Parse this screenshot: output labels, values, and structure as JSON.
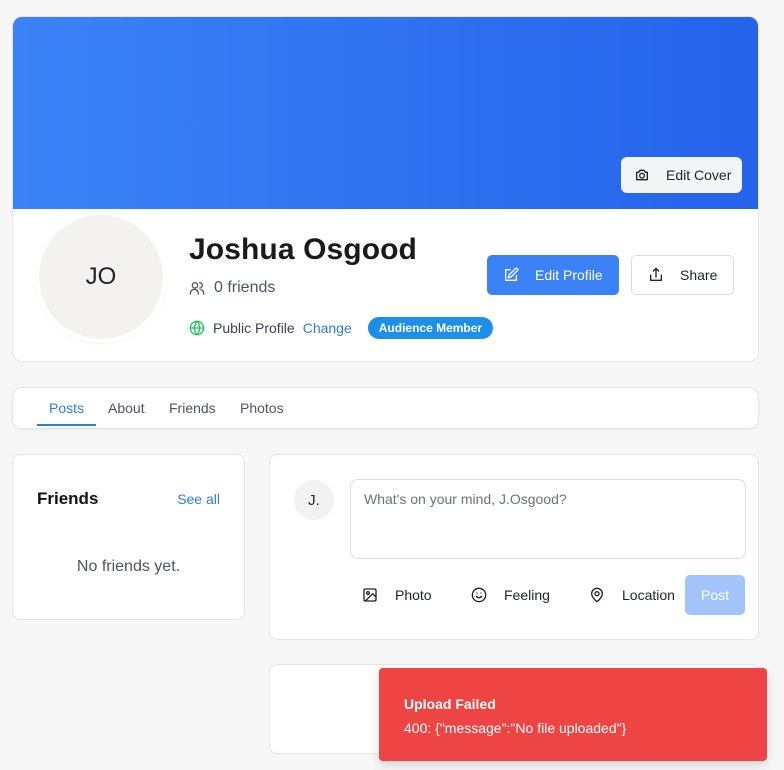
{
  "profile": {
    "initials": "JO",
    "name": "Joshua Osgood",
    "friends_count": "0 friends",
    "visibility": "Public Profile",
    "change_label": "Change",
    "role_badge": "Audience Member",
    "edit_cover_label": "Edit Cover",
    "edit_profile_label": "Edit Profile",
    "share_label": "Share"
  },
  "tabs": [
    {
      "label": "Posts",
      "active": true
    },
    {
      "label": "About",
      "active": false
    },
    {
      "label": "Friends",
      "active": false
    },
    {
      "label": "Photos",
      "active": false
    }
  ],
  "friends_panel": {
    "title": "Friends",
    "see_all": "See all",
    "empty": "No friends yet."
  },
  "composer": {
    "avatar": "J.",
    "placeholder": "What's on your mind, J.Osgood?",
    "actions": [
      {
        "label": "Photo",
        "icon": "image-icon"
      },
      {
        "label": "Feeling",
        "icon": "smile-icon"
      },
      {
        "label": "Location",
        "icon": "map-pin-icon"
      }
    ],
    "post_label": "Post"
  },
  "toast": {
    "title": "Upload Failed",
    "message": "400: {\"message\":\"No file uploaded\"}"
  },
  "colors": {
    "accent": "#3b82f6",
    "badge": "#1d8fe8",
    "error": "#ef4444",
    "success": "#22c55e"
  }
}
